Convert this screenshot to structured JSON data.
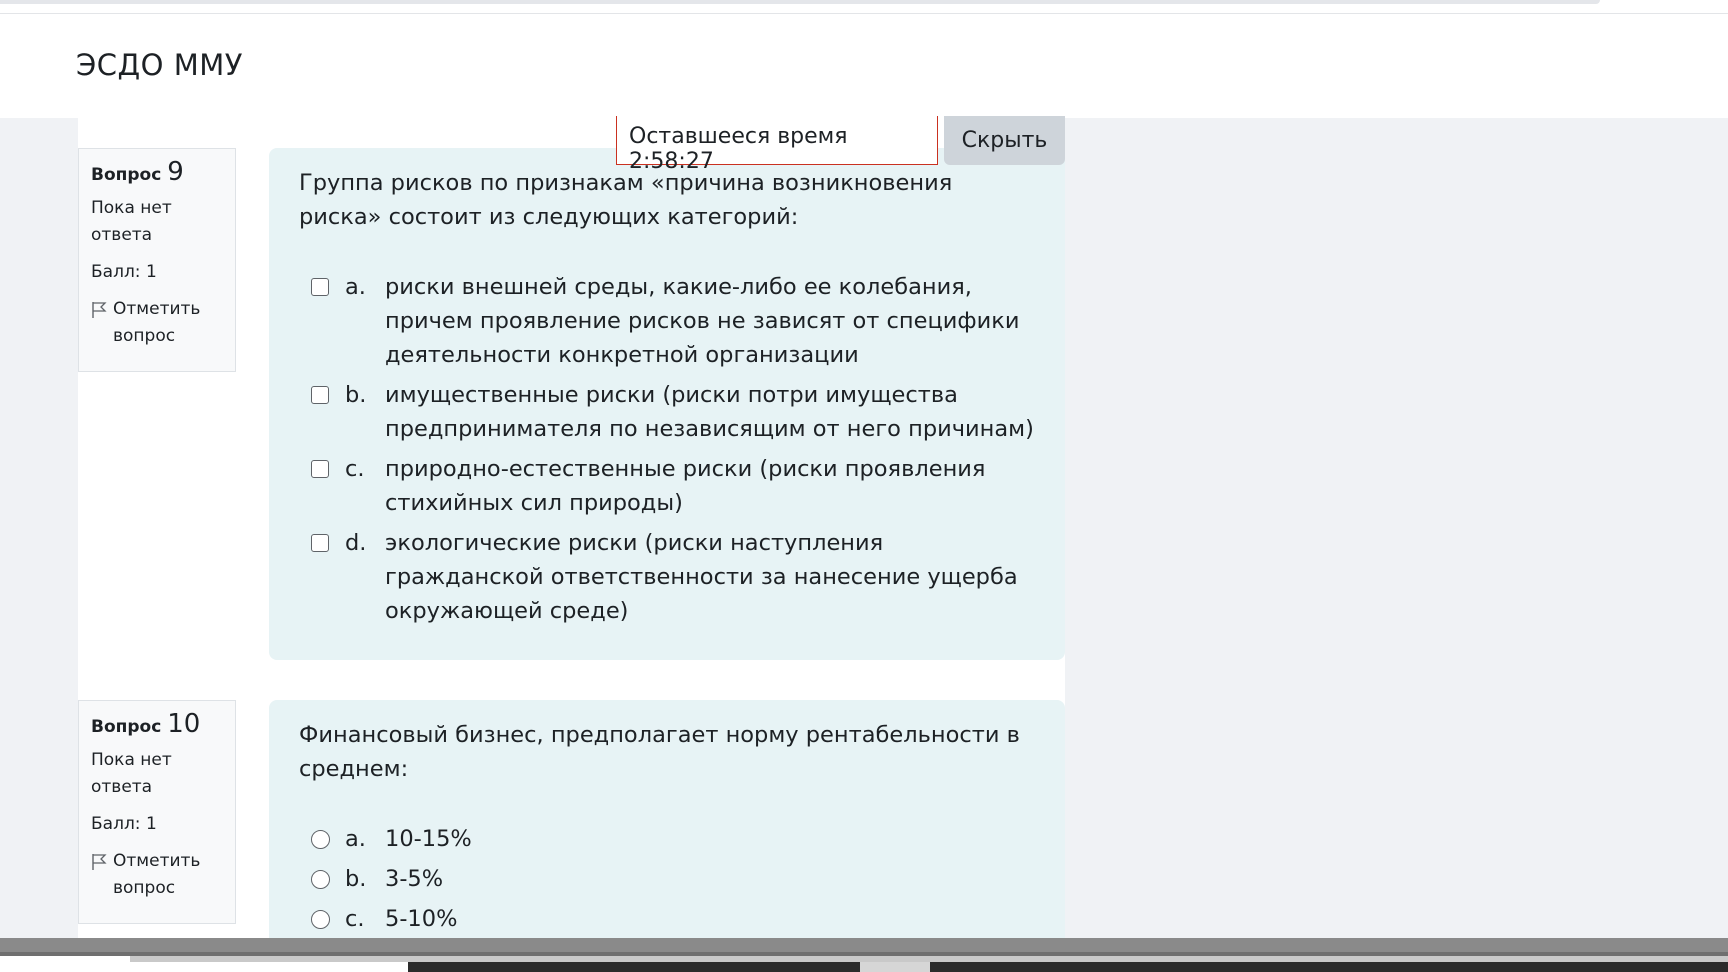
{
  "site": {
    "title": "ЭСДО ММУ"
  },
  "timer": {
    "text": "Оставшееся время 2:58:27"
  },
  "hide_button": {
    "label": "Скрыть"
  },
  "questions": [
    {
      "label": "Вопрос",
      "number": "9",
      "state": "Пока нет ответа",
      "grade": "Балл: 1",
      "flag": "Отметить вопрос",
      "text": "Группа рисков по признакам «причина возникновения риска» состоит из следующих категорий:",
      "input_type": "checkbox",
      "answers": [
        {
          "letter": "a.",
          "text": "риски внешней среды, какие-либо ее колебания, причем проявление рисков не зависят от специфики деятельности конкретной организации"
        },
        {
          "letter": "b.",
          "text": "имущественные риски (риски потри имущества предпринимателя по независящим от него причинам)"
        },
        {
          "letter": "c.",
          "text": "природно-естественные риски (риски проявления стихийных сил природы)"
        },
        {
          "letter": "d.",
          "text": "экологические риски (риски наступления гражданской ответственности за нанесение ущерба окружающей среде)"
        }
      ]
    },
    {
      "label": "Вопрос",
      "number": "10",
      "state": "Пока нет ответа",
      "grade": "Балл: 1",
      "flag": "Отметить вопрос",
      "text": "Финансовый бизнес, предполагает норму рентабельности в среднем:",
      "input_type": "radio",
      "answers": [
        {
          "letter": "a.",
          "text": "10-15%"
        },
        {
          "letter": "b.",
          "text": "3-5%"
        },
        {
          "letter": "c.",
          "text": "5-10%"
        }
      ]
    }
  ]
}
